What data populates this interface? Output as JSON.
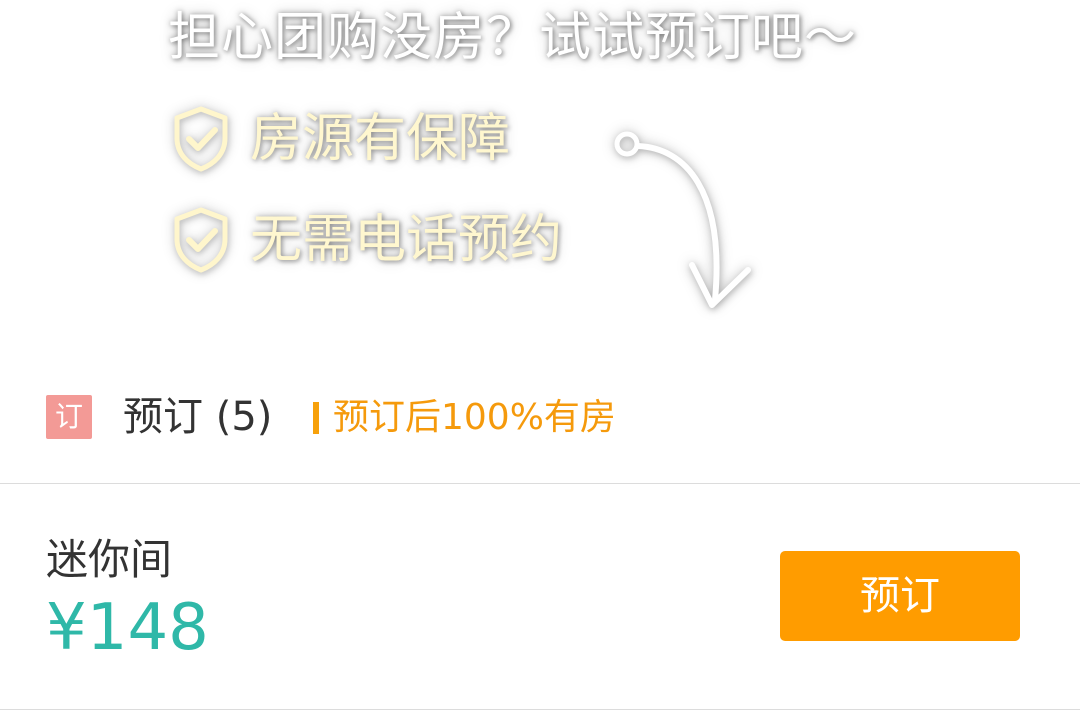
{
  "promo": {
    "headline": "担心团购没房？试试预订吧～",
    "features": [
      {
        "text": "房源有保障",
        "icon": "shield-check-icon"
      },
      {
        "text": "无需电话预约",
        "icon": "shield-check-icon"
      }
    ],
    "arrow_icon": "curved-arrow-down-icon",
    "colors": {
      "headline": "#ffffff",
      "feature_text": "#fff7cf"
    }
  },
  "section": {
    "badge": "订",
    "title": "预订 (5)",
    "note": "预订后100%有房",
    "colors": {
      "badge_bg": "#f39a96",
      "note": "#f59a0c"
    }
  },
  "room": {
    "name": "迷你间",
    "price": "¥148",
    "book_label": "预订",
    "colors": {
      "price": "#2fb8a8",
      "button": "#ff9c00"
    }
  }
}
